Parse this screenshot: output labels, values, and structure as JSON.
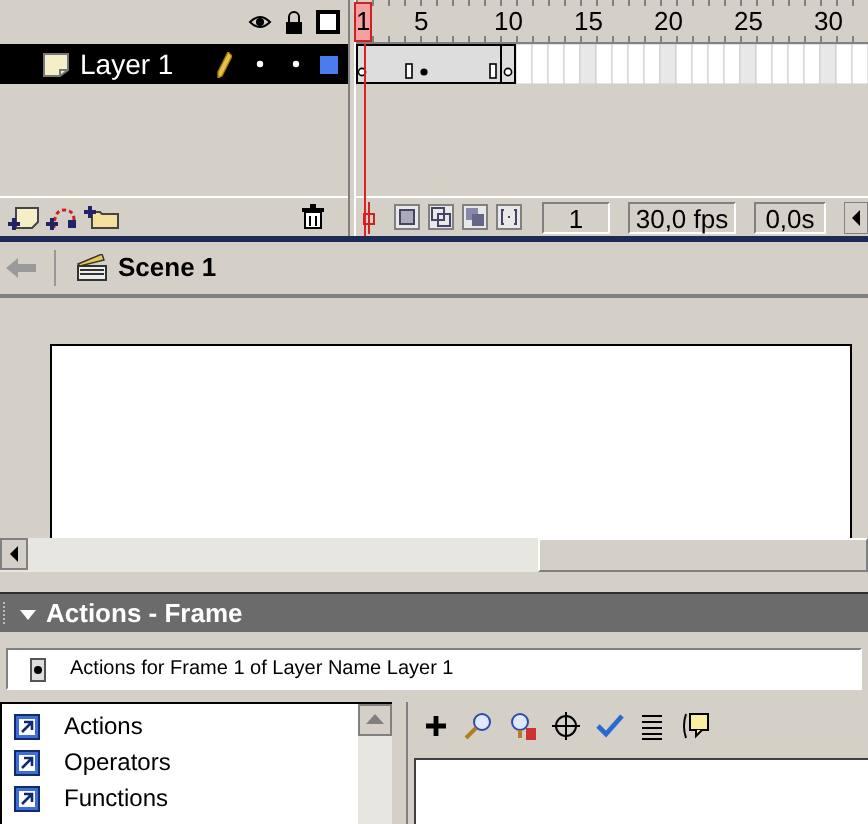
{
  "timeline": {
    "layers": [
      {
        "name": "Layer 1",
        "selected": true
      }
    ],
    "ruler": [
      "1",
      "5",
      "10",
      "15",
      "20",
      "25",
      "30"
    ],
    "current_frame": "1",
    "frame_rate": "30,0 fps",
    "elapsed": "0,0s"
  },
  "edit_bar": {
    "scene": "Scene 1"
  },
  "actions_panel": {
    "title": "Actions - Frame",
    "expanded": true,
    "target": "Actions for Frame 1 of Layer Name Layer 1",
    "categories": [
      {
        "label": "Actions"
      },
      {
        "label": "Operators"
      },
      {
        "label": "Functions"
      }
    ]
  }
}
